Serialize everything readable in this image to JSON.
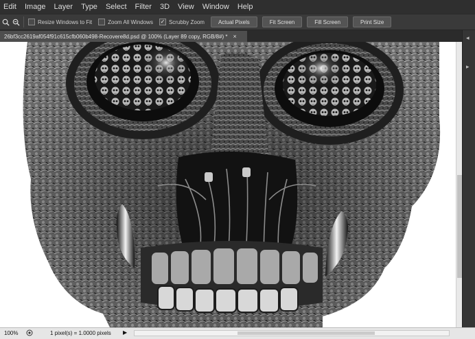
{
  "menu": [
    "Edit",
    "Image",
    "Layer",
    "Type",
    "Select",
    "Filter",
    "3D",
    "View",
    "Window",
    "Help"
  ],
  "options": {
    "resize_windows": {
      "label": "Resize Windows to Fit",
      "checked": false
    },
    "zoom_all": {
      "label": "Zoom All Windows",
      "checked": false
    },
    "scrubby": {
      "label": "Scrubby Zoom",
      "checked": true
    },
    "buttons": [
      "Actual Pixels",
      "Fit Screen",
      "Fill Screen",
      "Print Size"
    ]
  },
  "document": {
    "tab_title": "26bf3cc2619af054f91c615cfb060b498-Recovere8d.psd @ 100% (Layer 89 copy, RGB/8#) *",
    "close_glyph": "×"
  },
  "status": {
    "zoom": "100%",
    "info": "1 pixel(s) = 1.0000 pixels",
    "arrow": "▶"
  },
  "icons": {
    "zoom_tool": "magnifier-icon",
    "zoom_out": "zoom-out-icon",
    "status": "doc-info-icon"
  }
}
